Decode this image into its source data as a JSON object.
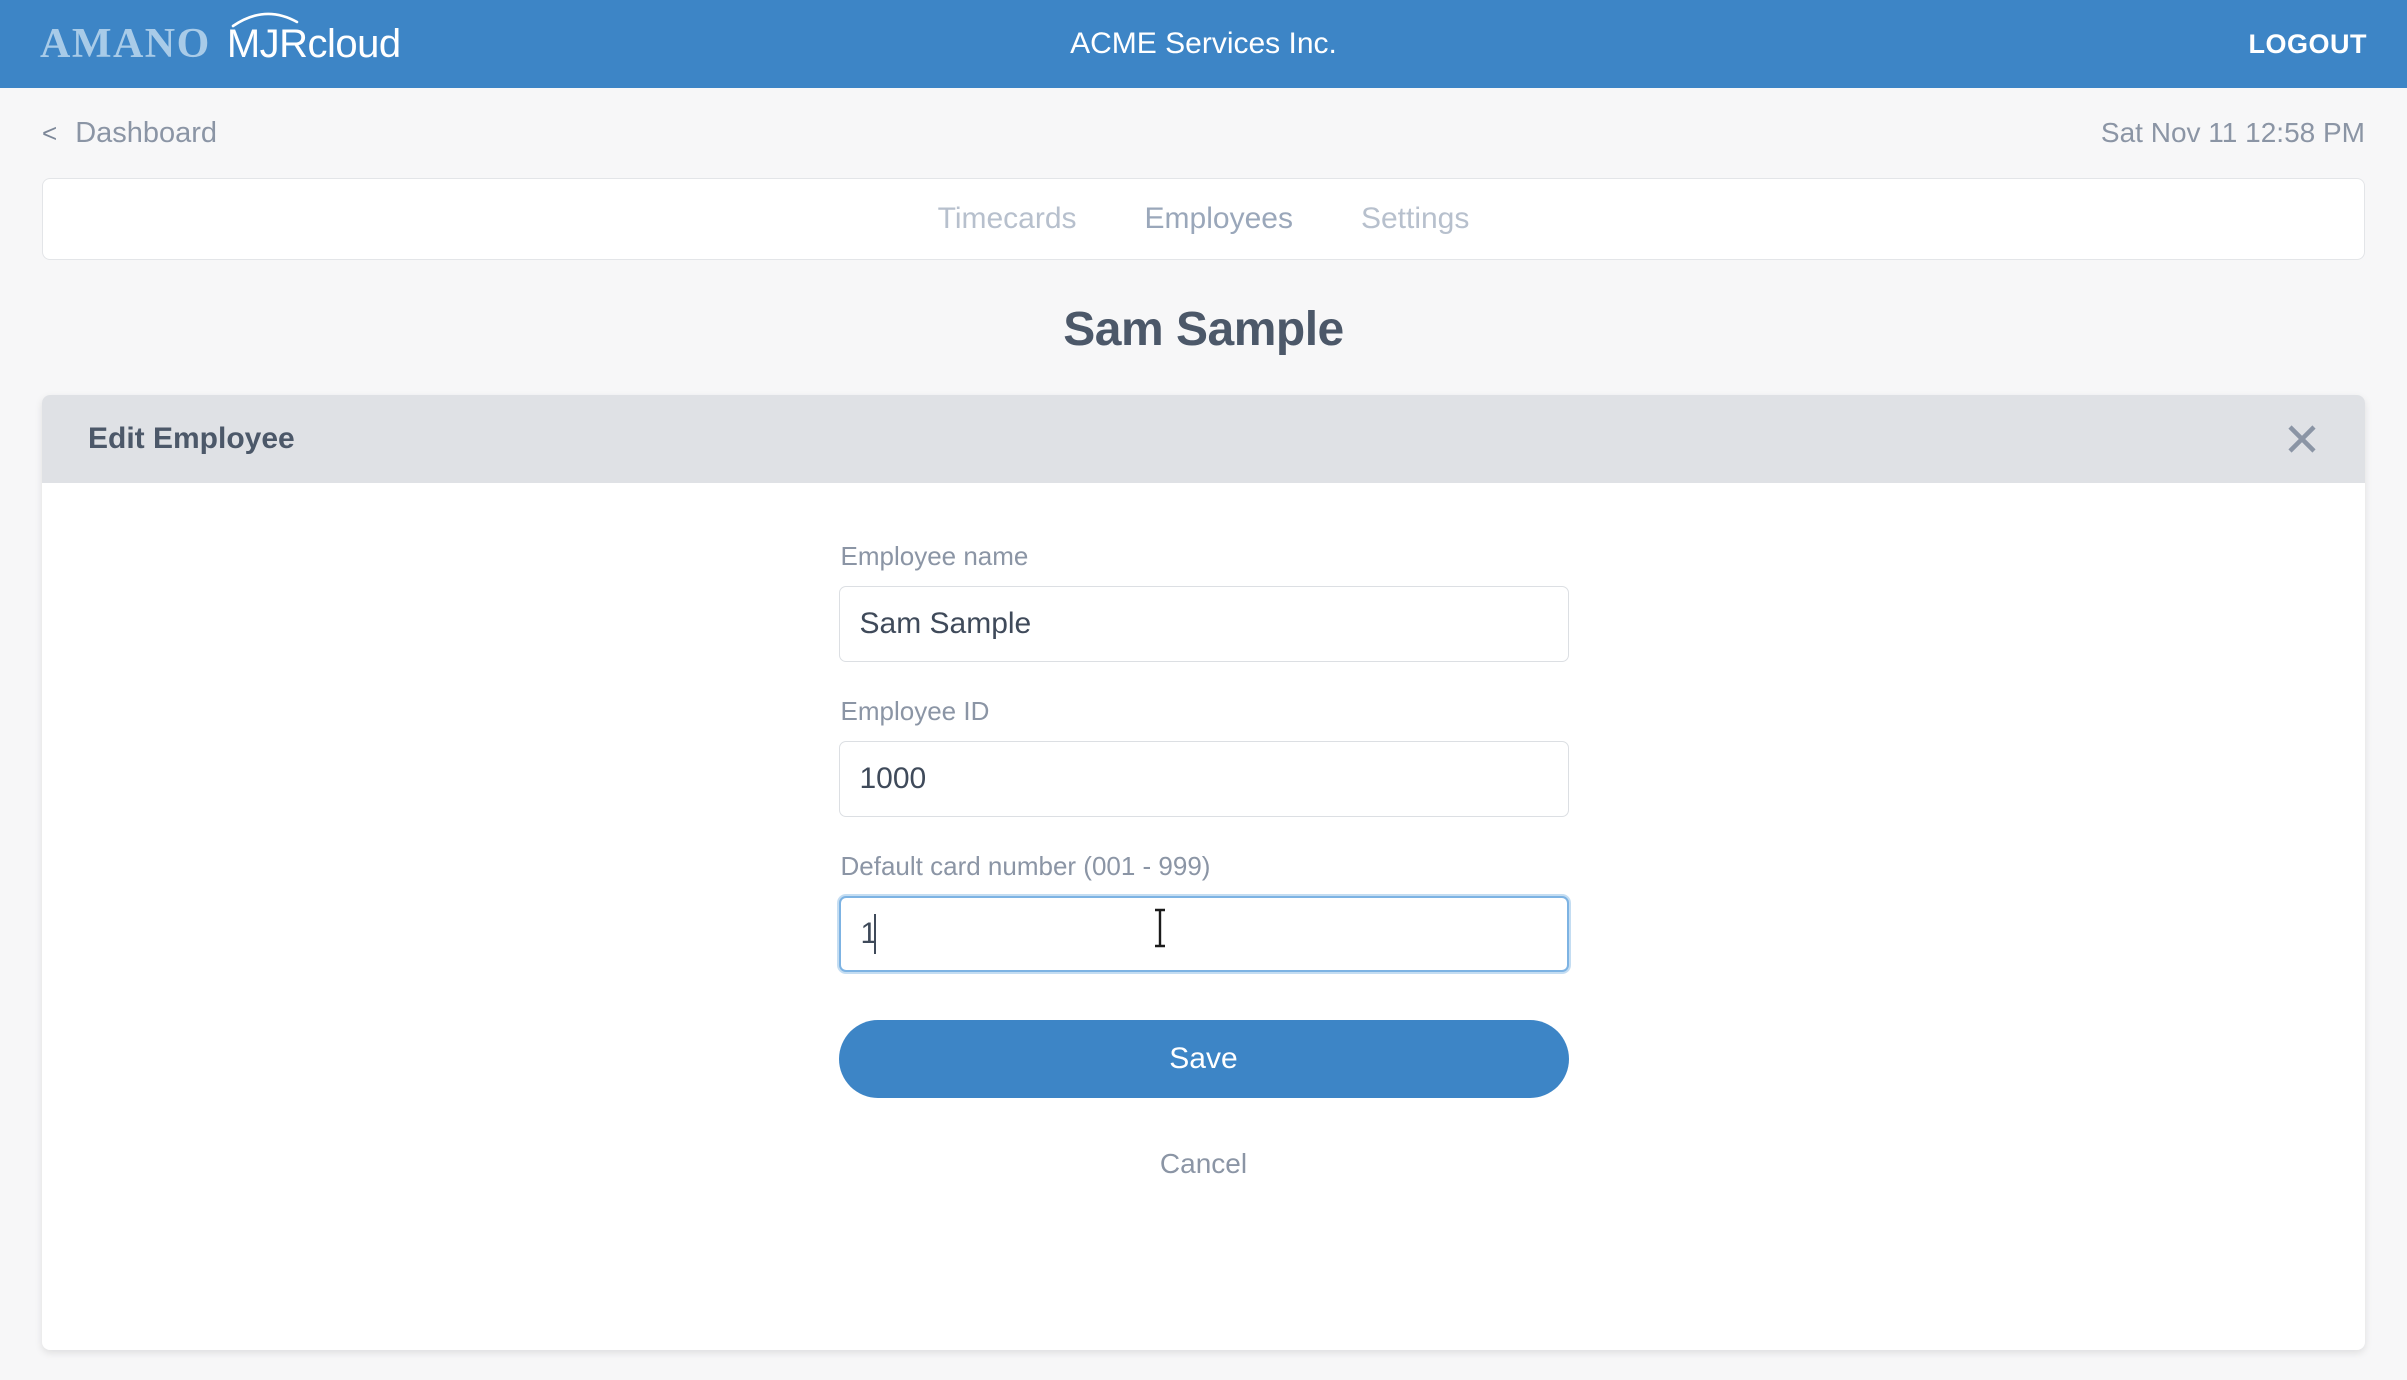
{
  "header": {
    "logo_primary": "AMANO",
    "logo_secondary": "MJRcloud",
    "company_title": "ACME Services Inc.",
    "logout_label": "LOGOUT",
    "background_color": "#3d85c6"
  },
  "subbar": {
    "back_chevron": "<",
    "breadcrumb_label": "Dashboard",
    "datetime": "Sat Nov 11 12:58 PM"
  },
  "nav": {
    "tabs": [
      {
        "label": "Timecards",
        "active": false
      },
      {
        "label": "Employees",
        "active": true
      },
      {
        "label": "Settings",
        "active": false
      }
    ]
  },
  "page": {
    "title": "Sam Sample"
  },
  "card": {
    "title": "Edit Employee",
    "close_icon": "close-icon",
    "form": {
      "fields": [
        {
          "label": "Employee name",
          "value": "Sam Sample",
          "placeholder": "",
          "focused": false
        },
        {
          "label": "Employee ID",
          "value": "1000",
          "placeholder": "",
          "focused": false
        },
        {
          "label": "Default card number (001 - 999)",
          "value": "1",
          "placeholder": "",
          "focused": true
        }
      ],
      "save_label": "Save",
      "cancel_label": "Cancel"
    }
  },
  "colors": {
    "accent": "#3d85c6",
    "page_background": "#f7f7f8",
    "card_header": "#dfe1e5",
    "text_dark": "#4c5869",
    "text_muted": "#8b95a5",
    "tab_inactive": "#b7c0cd",
    "tab_active": "#9aa7ba",
    "focus_ring": "#7db3e3"
  }
}
